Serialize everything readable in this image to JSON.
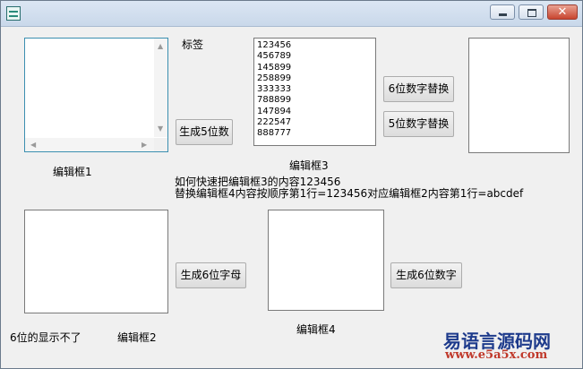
{
  "window": {
    "minimize_glyph": "",
    "maximize_glyph": "",
    "close_glyph": "✕",
    "icon": "app-icon"
  },
  "labels": {
    "tag": "标签",
    "edit1": "编辑框1",
    "edit2": "编辑框2",
    "edit3": "编辑框3",
    "edit4": "编辑框4",
    "question_line1": "如何快速把编辑框3的内容123456",
    "question_line2": "替换编辑框4内容按顺序第1行=123456对应编辑框2内容第1行=abcdef",
    "six_not_shown": "6位的显示不了"
  },
  "buttons": {
    "gen5_digits": "生成5位数",
    "replace6_digits": "6位数字替换",
    "replace5_digits": "5位数字替换",
    "gen6_letters": "生成6位字母",
    "gen6_digits": "生成6位数字"
  },
  "edit3_lines": [
    "123456",
    "456789",
    "145899",
    "258899",
    "333333",
    "788899",
    "147894",
    "222547",
    "888777"
  ],
  "watermark": {
    "title": "易语言源码网",
    "url": "www.e5a5x.com"
  },
  "colors": {
    "window_bg": "#f0f0f0",
    "close_button": "#c8452f",
    "watermark_title": "#1e3b8c",
    "watermark_url": "#c0392b"
  }
}
